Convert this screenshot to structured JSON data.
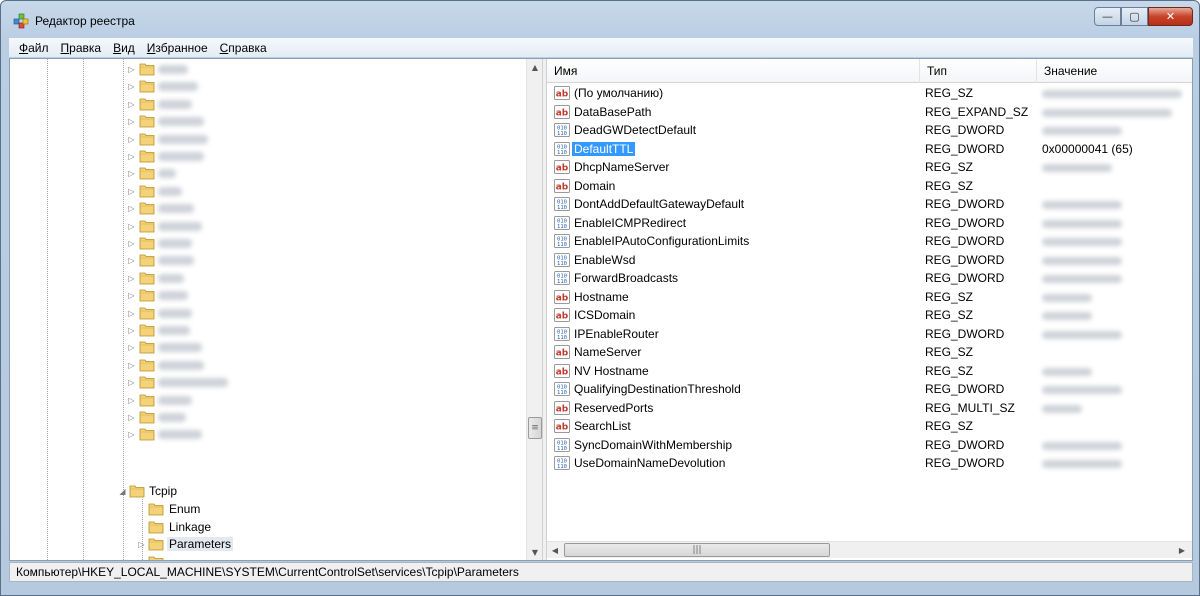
{
  "window": {
    "title": "Редактор реестра",
    "minimize": "—",
    "maximize": "▢",
    "close": "✕"
  },
  "menu": [
    {
      "label": "Файл",
      "accel": "Ф",
      "rest": "айл"
    },
    {
      "label": "Правка",
      "accel": "П",
      "rest": "равка"
    },
    {
      "label": "Вид",
      "accel": "В",
      "rest": "ид"
    },
    {
      "label": "Избранное",
      "accel": "И",
      "rest": "збранное"
    },
    {
      "label": "Справка",
      "accel": "С",
      "rest": "правка"
    }
  ],
  "tree": {
    "expanded_key": "Tcpip",
    "children": [
      "Enum",
      "Linkage",
      "Parameters"
    ],
    "selected": "Parameters"
  },
  "list": {
    "columns": {
      "name": "Имя",
      "type": "Тип",
      "data": "Значение"
    },
    "rows": [
      {
        "name": "(По умолчанию)",
        "type": "REG_SZ",
        "icon": "string-value-icon"
      },
      {
        "name": "DataBasePath",
        "type": "REG_EXPAND_SZ",
        "icon": "string-value-icon"
      },
      {
        "name": "DeadGWDetectDefault",
        "type": "REG_DWORD",
        "icon": "binary-value-icon"
      },
      {
        "name": "DefaultTTL",
        "type": "REG_DWORD",
        "icon": "binary-value-icon",
        "data": "0x00000041 (65)",
        "selected": true
      },
      {
        "name": "DhcpNameServer",
        "type": "REG_SZ",
        "icon": "string-value-icon"
      },
      {
        "name": "Domain",
        "type": "REG_SZ",
        "icon": "string-value-icon"
      },
      {
        "name": "DontAddDefaultGatewayDefault",
        "type": "REG_DWORD",
        "icon": "binary-value-icon"
      },
      {
        "name": "EnableICMPRedirect",
        "type": "REG_DWORD",
        "icon": "binary-value-icon"
      },
      {
        "name": "EnableIPAutoConfigurationLimits",
        "type": "REG_DWORD",
        "icon": "binary-value-icon"
      },
      {
        "name": "EnableWsd",
        "type": "REG_DWORD",
        "icon": "binary-value-icon"
      },
      {
        "name": "ForwardBroadcasts",
        "type": "REG_DWORD",
        "icon": "binary-value-icon"
      },
      {
        "name": "Hostname",
        "type": "REG_SZ",
        "icon": "string-value-icon"
      },
      {
        "name": "ICSDomain",
        "type": "REG_SZ",
        "icon": "string-value-icon"
      },
      {
        "name": "IPEnableRouter",
        "type": "REG_DWORD",
        "icon": "binary-value-icon"
      },
      {
        "name": "NameServer",
        "type": "REG_SZ",
        "icon": "string-value-icon"
      },
      {
        "name": "NV Hostname",
        "type": "REG_SZ",
        "icon": "string-value-icon"
      },
      {
        "name": "QualifyingDestinationThreshold",
        "type": "REG_DWORD",
        "icon": "binary-value-icon"
      },
      {
        "name": "ReservedPorts",
        "type": "REG_MULTI_SZ",
        "icon": "string-value-icon"
      },
      {
        "name": "SearchList",
        "type": "REG_SZ",
        "icon": "string-value-icon"
      },
      {
        "name": "SyncDomainWithMembership",
        "type": "REG_DWORD",
        "icon": "binary-value-icon"
      },
      {
        "name": "UseDomainNameDevolution",
        "type": "REG_DWORD",
        "icon": "binary-value-icon"
      }
    ]
  },
  "status": {
    "path": "Компьютер\\HKEY_LOCAL_MACHINE\\SYSTEM\\CurrentControlSet\\services\\Tcpip\\Parameters"
  },
  "colors": {
    "selection": "#3399ff",
    "folder": "#e8c25a",
    "title_bar": "#c7d8ea"
  }
}
